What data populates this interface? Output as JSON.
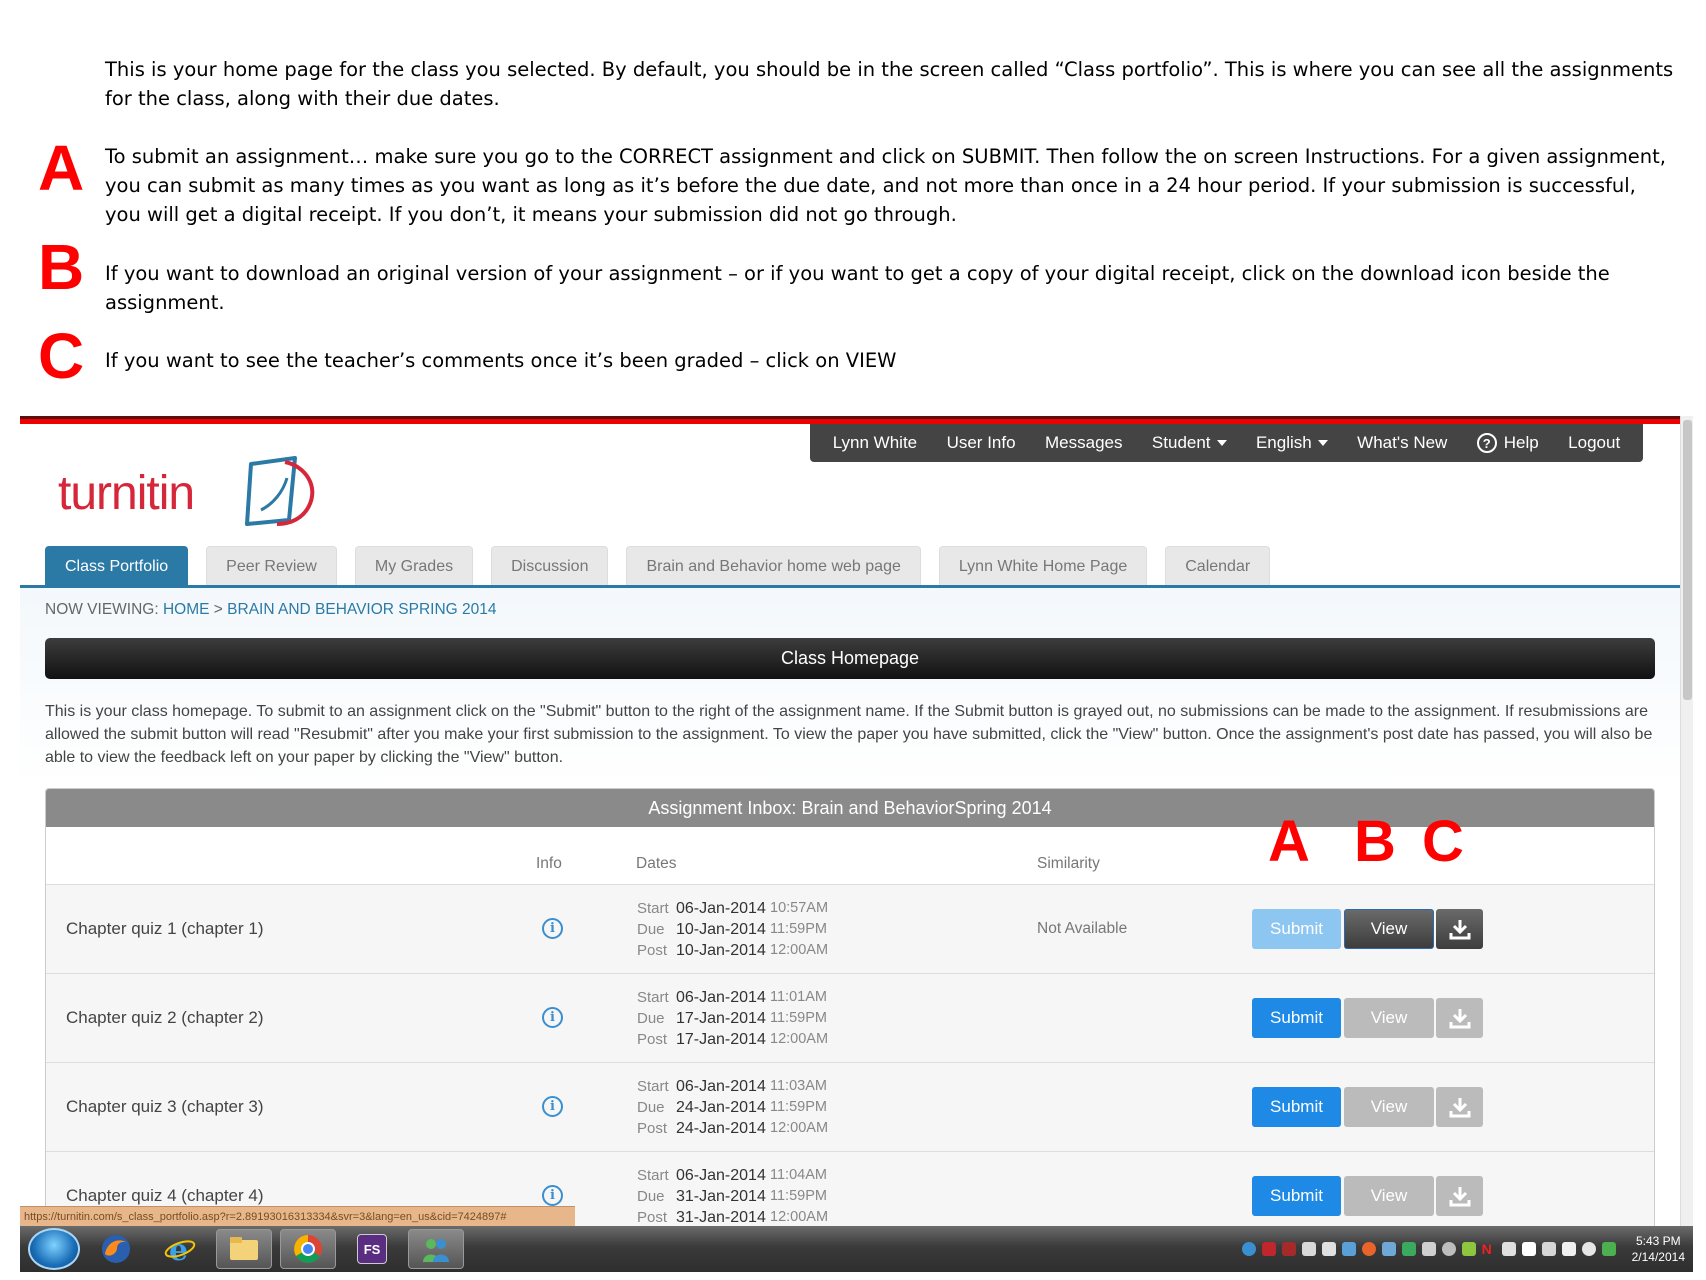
{
  "instructions": {
    "intro": "This is your home page for the class you selected.  By default, you should be in the screen called “Class portfolio”. This is where you can see all the assignments for the class, along with their due dates.",
    "items": [
      {
        "letter": "A",
        "text": "To submit an assignment… make sure you go to the CORRECT assignment and click on SUBMIT.  Then follow the on screen Instructions.  For a given assignment, you can submit as many times as you want as long as it’s before the due date, and not more than once in a 24 hour period. If your submission is successful, you will get a digital receipt. If you don’t, it means your submission did not go through."
      },
      {
        "letter": "B",
        "text": "If you want to download an original version of your assignment – or if you want to get a copy of your digital receipt, click on the download icon beside the assignment."
      },
      {
        "letter": "C",
        "text": "If you want to see the teacher’s comments once it’s been graded – click on VIEW"
      }
    ]
  },
  "topnav": {
    "user": "Lynn White",
    "user_info": "User Info",
    "messages": "Messages",
    "student": "Student",
    "language": "English",
    "whats_new": "What's New",
    "help": "Help",
    "logout": "Logout"
  },
  "logo": {
    "text": "turnitin"
  },
  "tabs": [
    "Class Portfolio",
    "Peer Review",
    "My Grades",
    "Discussion",
    "Brain and Behavior home web page",
    "Lynn White Home Page",
    "Calendar"
  ],
  "breadcrumb": {
    "prefix": "NOW VIEWING:",
    "home": "HOME",
    "sep": ">",
    "course": "BRAIN AND BEHAVIOR SPRING 2014"
  },
  "class_homepage": {
    "title": "Class Homepage",
    "description": "This is your class homepage. To submit to an assignment click on the \"Submit\" button to the right of the assignment name. If the Submit button is grayed out, no submissions can be made to the assignment. If resubmissions are allowed the submit button will read \"Resubmit\" after you make your first submission to the assignment. To view the paper you have submitted, click the \"View\" button. Once the assignment's post date has passed, you will also be able to view the feedback left on your paper by clicking the \"View\" button."
  },
  "inbox": {
    "title": "Assignment Inbox: Brain and BehaviorSpring 2014",
    "columns": {
      "info": "Info",
      "dates": "Dates",
      "similarity": "Similarity"
    },
    "annotation_letters": [
      "A",
      "B",
      "C"
    ],
    "date_labels": {
      "start": "Start",
      "due": "Due",
      "post": "Post"
    },
    "submit_label": "Submit",
    "view_label": "View",
    "rows": [
      {
        "name": "Chapter quiz 1 (chapter 1)",
        "start_date": "06-Jan-2014",
        "start_time": "10:57AM",
        "due_date": "10-Jan-2014",
        "due_time": "11:59PM",
        "post_date": "10-Jan-2014",
        "post_time": "12:00AM",
        "similarity": "Not Available"
      },
      {
        "name": "Chapter quiz 2 (chapter 2)",
        "start_date": "06-Jan-2014",
        "start_time": "11:01AM",
        "due_date": "17-Jan-2014",
        "due_time": "11:59PM",
        "post_date": "17-Jan-2014",
        "post_time": "12:00AM",
        "similarity": ""
      },
      {
        "name": "Chapter quiz 3 (chapter 3)",
        "start_date": "06-Jan-2014",
        "start_time": "11:03AM",
        "due_date": "24-Jan-2014",
        "due_time": "11:59PM",
        "post_date": "24-Jan-2014",
        "post_time": "12:00AM",
        "similarity": ""
      },
      {
        "name": "Chapter quiz 4 (chapter 4)",
        "start_date": "06-Jan-2014",
        "start_time": "11:04AM",
        "due_date": "31-Jan-2014",
        "due_time": "11:59PM",
        "post_date": "31-Jan-2014",
        "post_time": "12:00AM",
        "similarity": ""
      }
    ]
  },
  "status_url": "https://turnitin.com/s_class_portfolio.asp?r=2.89193016313334&svr=3&lang=en_us&cid=7424897#",
  "taskbar": {
    "fs_label": "FS",
    "time": "5:43 PM",
    "date": "2/14/2014"
  },
  "colors": {
    "annotation_red": "#ff0000",
    "tab_active": "#2b7aa6",
    "submit_blue": "#1e8ae6",
    "submit_disabled": "#8ec6f2",
    "brand_red": "#d6263a"
  }
}
